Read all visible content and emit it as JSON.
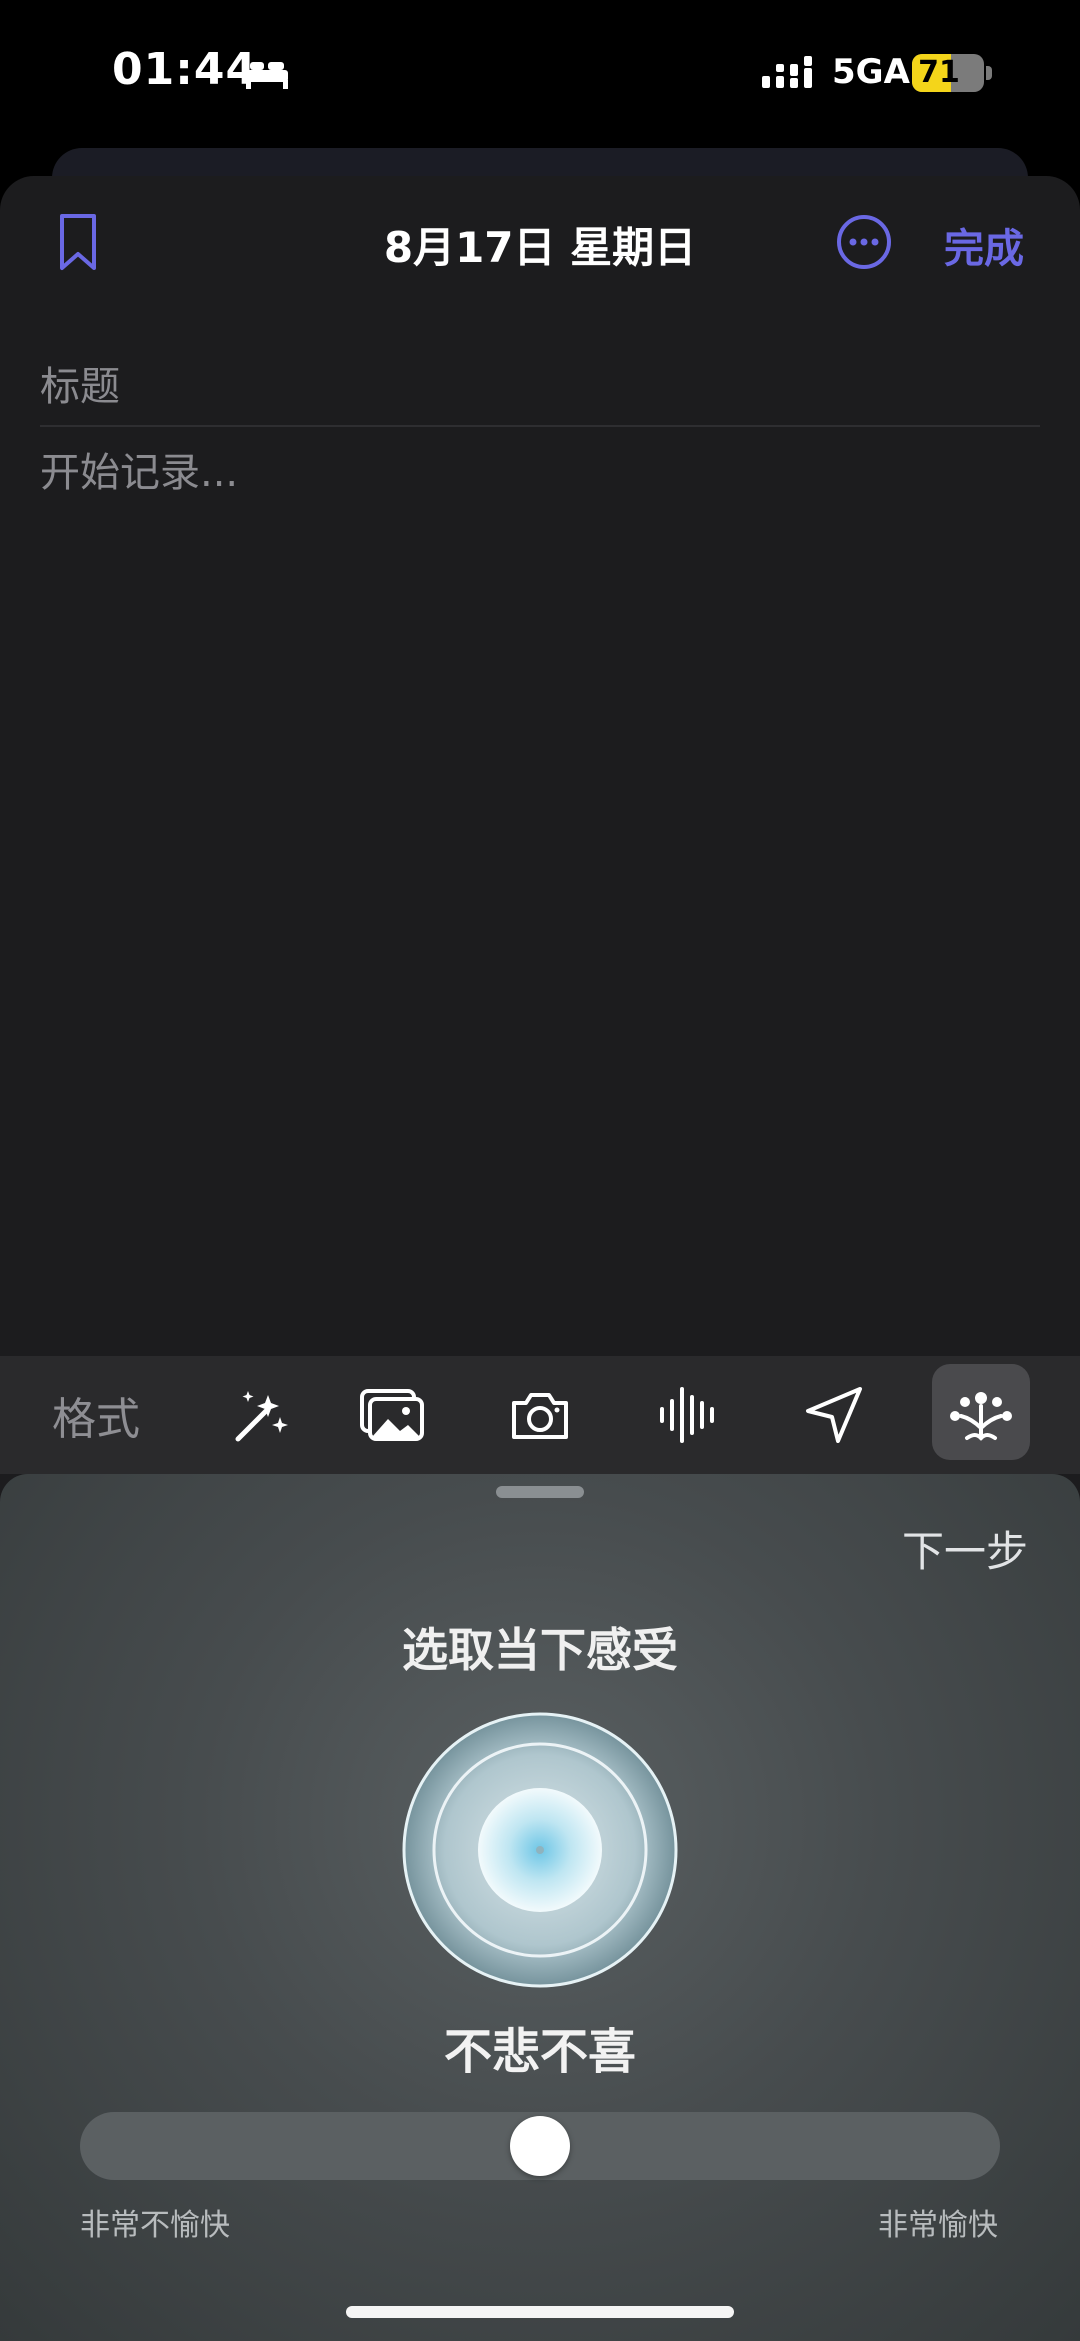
{
  "status_bar": {
    "time": "01:44",
    "network": "5GA",
    "battery_level": 71,
    "battery_text": "71"
  },
  "header": {
    "date_title": "8月17日 星期日",
    "done_label": "完成",
    "accent_color": "#6a68e4"
  },
  "editor": {
    "title_placeholder": "标题",
    "body_placeholder": "开始记录..."
  },
  "toolbar": {
    "format_label": "格式",
    "icons": [
      "magic-wand-icon",
      "photo-library-icon",
      "camera-icon",
      "audio-waveform-icon",
      "location-arrow-icon",
      "mood-burst-icon"
    ]
  },
  "mood_panel": {
    "next_label": "下一步",
    "heading": "选取当下感受",
    "current_mood": "不悲不喜",
    "slider_value": 0.5,
    "slider_min_label": "非常不愉快",
    "slider_max_label": "非常愉快"
  }
}
